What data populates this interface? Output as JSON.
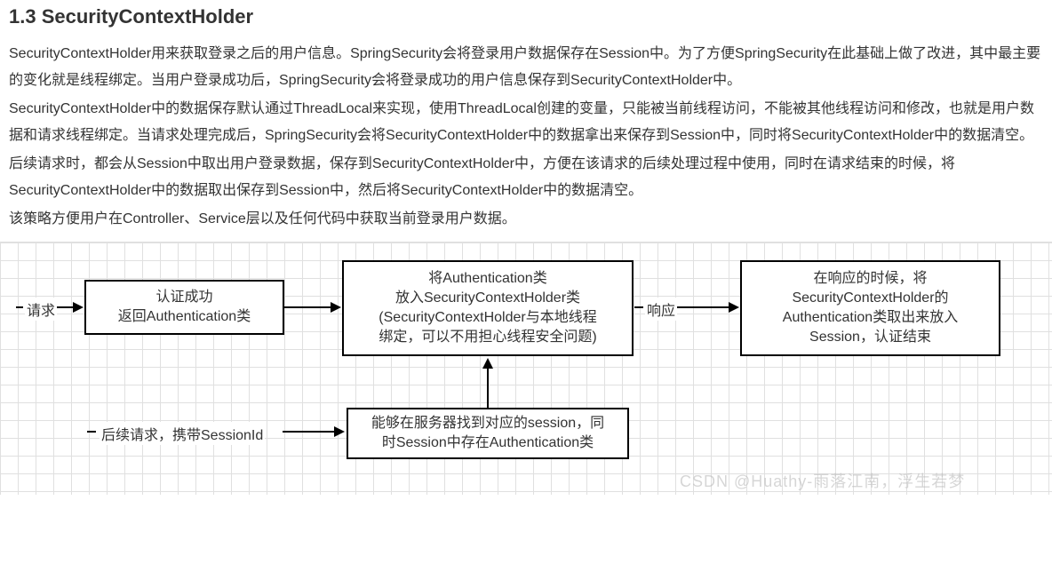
{
  "heading": "1.3 SecurityContextHolder",
  "paragraphs": {
    "p1": "SecurityContextHolder用来获取登录之后的用户信息。SpringSecurity会将登录用户数据保存在Session中。为了方便SpringSecurity在此基础上做了改进，其中最主要的变化就是线程绑定。当用户登录成功后，SpringSecurity会将登录成功的用户信息保存到SecurityContextHolder中。",
    "p2": "SecurityContextHolder中的数据保存默认通过ThreadLocal来实现，使用ThreadLocal创建的变量，只能被当前线程访问，不能被其他线程访问和修改，也就是用户数据和请求线程绑定。当请求处理完成后，SpringSecurity会将SecurityContextHolder中的数据拿出来保存到Session中，同时将SecurityContextHolder中的数据清空。",
    "p3": "后续请求时，都会从Session中取出用户登录数据，保存到SecurityContextHolder中，方便在该请求的后续处理过程中使用，同时在请求结束的时候，将SecurityContextHolder中的数据取出保存到Session中，然后将SecurityContextHolder中的数据清空。",
    "p4": "该策略方便用户在Controller、Service层以及任何代码中获取当前登录用户数据。"
  },
  "diagram": {
    "label_request": "请求",
    "box1_line1": "认证成功",
    "box1_line2": "返回Authentication类",
    "box2_line1": "将Authentication类",
    "box2_line2": "放入SecurityContextHolder类",
    "box2_line3": "(SecurityContextHolder与本地线程",
    "box2_line4": "绑定，可以不用担心线程安全问题)",
    "label_response": "响应",
    "box3_line1": "在响应的时候，将",
    "box3_line2": "SecurityContextHolder的",
    "box3_line3": "Authentication类取出来放入",
    "box3_line4": "Session，认证结束",
    "label_followup": "后续请求，携带SessionId",
    "box4_line1": "能够在服务器找到对应的session，同",
    "box4_line2": "时Session中存在Authentication类"
  },
  "watermark": "CSDN @Huathy-雨落江南，浮生若梦"
}
